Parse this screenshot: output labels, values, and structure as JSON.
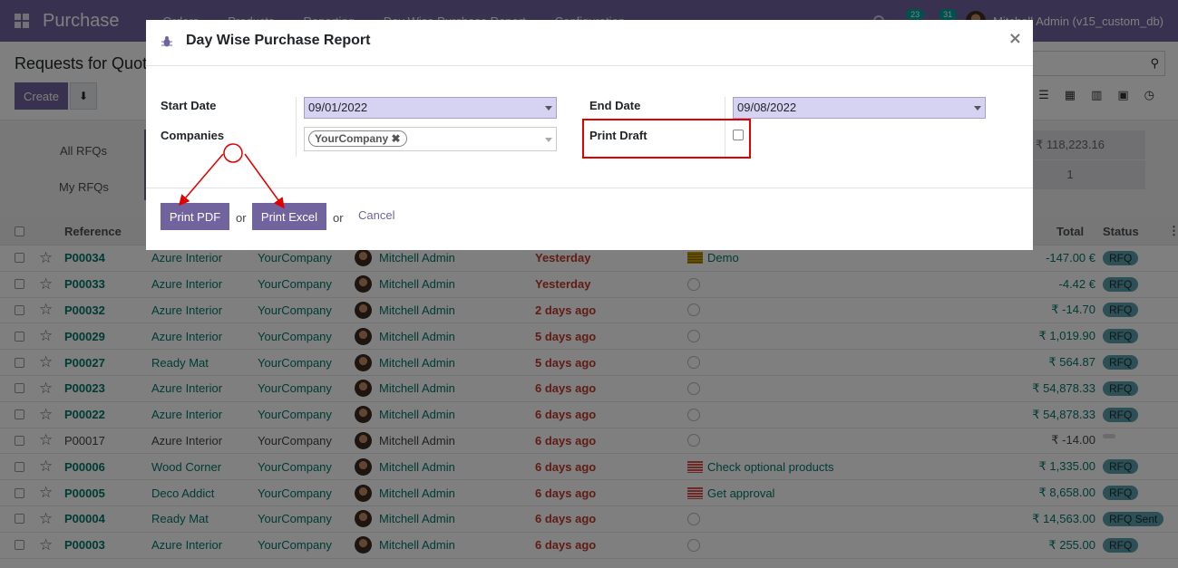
{
  "app": {
    "brand": "Purchase",
    "menu": [
      "Orders",
      "Products",
      "Reporting",
      "Day Wise Purchase Report",
      "Configuration"
    ],
    "chat_count": "23",
    "activity_count": "31",
    "user_label": "Mitchell Admin (v15_custom_db)"
  },
  "control_panel": {
    "breadcrumb": "Requests for Quotation",
    "create_label": "Create"
  },
  "dashboard": {
    "all_rfqs": "All RFQs",
    "my_rfqs": "My RFQs",
    "total_value": "₹ 118,223.16",
    "count_value": "1"
  },
  "table": {
    "headers": {
      "reference": "Reference",
      "total": "Total",
      "status": "Status"
    },
    "rows": [
      {
        "ref": "P00034",
        "vendor": "Azure Interior",
        "company": "YourCompany",
        "buyer": "Mitchell Admin",
        "deadline": "Yesterday",
        "activity": "Demo",
        "activity_kind": "yellow",
        "total": "-147.00 €",
        "status": "RFQ",
        "style": "link"
      },
      {
        "ref": "P00033",
        "vendor": "Azure Interior",
        "company": "YourCompany",
        "buyer": "Mitchell Admin",
        "deadline": "Yesterday",
        "activity": "",
        "activity_kind": "none",
        "total": "-4.42 €",
        "status": "RFQ",
        "style": "link"
      },
      {
        "ref": "P00032",
        "vendor": "Azure Interior",
        "company": "YourCompany",
        "buyer": "Mitchell Admin",
        "deadline": "2 days ago",
        "activity": "",
        "activity_kind": "none",
        "total": "₹ -14.70",
        "status": "RFQ",
        "style": "link"
      },
      {
        "ref": "P00029",
        "vendor": "Azure Interior",
        "company": "YourCompany",
        "buyer": "Mitchell Admin",
        "deadline": "5 days ago",
        "activity": "",
        "activity_kind": "none",
        "total": "₹ 1,019.90",
        "status": "RFQ",
        "style": "link"
      },
      {
        "ref": "P00027",
        "vendor": "Ready Mat",
        "company": "YourCompany",
        "buyer": "Mitchell Admin",
        "deadline": "5 days ago",
        "activity": "",
        "activity_kind": "none",
        "total": "₹ 564.87",
        "status": "RFQ",
        "style": "link"
      },
      {
        "ref": "P00023",
        "vendor": "Azure Interior",
        "company": "YourCompany",
        "buyer": "Mitchell Admin",
        "deadline": "6 days ago",
        "activity": "",
        "activity_kind": "none",
        "total": "₹ 54,878.33",
        "status": "RFQ",
        "style": "link"
      },
      {
        "ref": "P00022",
        "vendor": "Azure Interior",
        "company": "YourCompany",
        "buyer": "Mitchell Admin",
        "deadline": "6 days ago",
        "activity": "",
        "activity_kind": "none",
        "total": "₹ 54,878.33",
        "status": "RFQ",
        "style": "link"
      },
      {
        "ref": "P00017",
        "vendor": "Azure Interior",
        "company": "YourCompany",
        "buyer": "Mitchell Admin",
        "deadline": "6 days ago",
        "activity": "",
        "activity_kind": "none",
        "total": "₹ -14.00",
        "status": "",
        "style": "dark"
      },
      {
        "ref": "P00006",
        "vendor": "Wood Corner",
        "company": "YourCompany",
        "buyer": "Mitchell Admin",
        "deadline": "6 days ago",
        "activity": "Check optional products",
        "activity_kind": "red",
        "total": "₹ 1,335.00",
        "status": "RFQ",
        "style": "link"
      },
      {
        "ref": "P00005",
        "vendor": "Deco Addict",
        "company": "YourCompany",
        "buyer": "Mitchell Admin",
        "deadline": "6 days ago",
        "activity": "Get approval",
        "activity_kind": "red",
        "total": "₹ 8,658.00",
        "status": "RFQ",
        "style": "link"
      },
      {
        "ref": "P00004",
        "vendor": "Ready Mat",
        "company": "YourCompany",
        "buyer": "Mitchell Admin",
        "deadline": "6 days ago",
        "activity": "",
        "activity_kind": "none",
        "total": "₹ 14,563.00",
        "status": "RFQ Sent",
        "style": "link"
      },
      {
        "ref": "P00003",
        "vendor": "Azure Interior",
        "company": "YourCompany",
        "buyer": "Mitchell Admin",
        "deadline": "6 days ago",
        "activity": "",
        "activity_kind": "none",
        "total": "₹ 255.00",
        "status": "RFQ",
        "style": "link"
      }
    ]
  },
  "modal": {
    "title": "Day Wise Purchase Report",
    "close": "×",
    "start_date_label": "Start Date",
    "start_date": "09/01/2022",
    "end_date_label": "End Date",
    "end_date": "09/08/2022",
    "companies_label": "Companies",
    "company_tag": "YourCompany",
    "print_draft_label": "Print Draft",
    "print_pdf": "Print PDF",
    "print_excel": "Print Excel",
    "or": "or",
    "cancel": "Cancel"
  },
  "colors": {
    "brand": "#71639e",
    "link": "#01766b",
    "late": "#c0392b",
    "highlight": "#e00000"
  }
}
